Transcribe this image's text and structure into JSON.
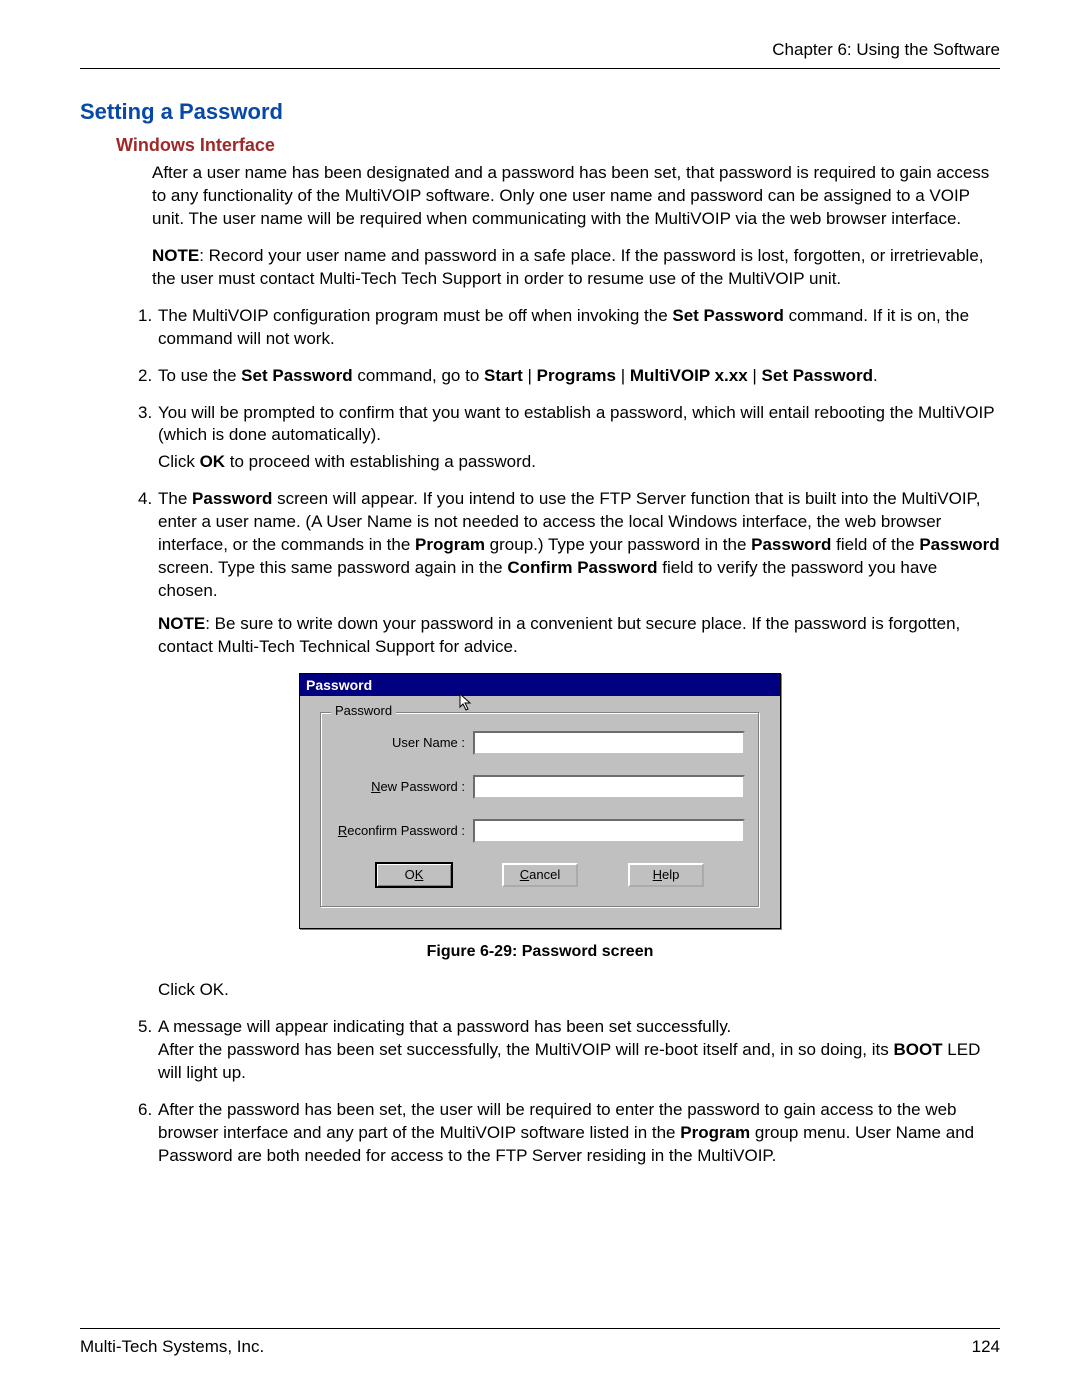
{
  "header": {
    "chapter": "Chapter 6: Using the Software"
  },
  "section": {
    "title": "Setting a Password",
    "subtitle": "Windows Interface"
  },
  "intro": "After a user name has been designated and a password has been set, that password is required to gain access to any functionality of the MultiVOIP software. Only one user name and password can be assigned to a VOIP unit.  The user name will be required when communicating with the MultiVOIP via the web browser interface.",
  "note1_label": "NOTE",
  "note1": ":  Record your user name and password in a safe place. If the password is lost, forgotten, or irretrievable, the user must contact Multi-Tech Tech Support in order to resume use of the MultiVOIP unit.",
  "steps": {
    "s1_pre": "The MultiVOIP configuration program must be off when invoking the ",
    "s1_bold": "Set Password",
    "s1_post": " command.  If it is on, the command will not work.",
    "s2_a": "To use the ",
    "s2_b1": "Set Password",
    "s2_c": " command, go to ",
    "s2_b2": "Start",
    "s2_b3": "Programs",
    "s2_b4": "MultiVOIP x.xx",
    "s2_b5": "Set Password",
    "s3": "You will be prompted to confirm that you want to establish a password, which will entail rebooting the MultiVOIP (which is done automatically).",
    "s3_click_a": "Click ",
    "s3_click_b": "OK",
    "s3_click_c": " to proceed with establishing a password.",
    "s4_a": "The ",
    "s4_b1": "Password",
    "s4_c": " screen will appear.  If you intend to use the FTP Server function that is built into the MultiVOIP, enter a user name. (A User Name is not needed to access the local Windows interface, the web browser interface, or the commands in the ",
    "s4_b2": "Program",
    "s4_d": " group.) Type your password in the ",
    "s4_b3": "Password",
    "s4_e": " field of the ",
    "s4_b4": "Password",
    "s4_f": " screen.  Type this same password again in the ",
    "s4_b5": "Confirm Password",
    "s4_g": " field to verify the password you have chosen.",
    "s4_note_label": "NOTE",
    "s4_note": ":  Be sure to write down your password in a convenient but secure place.  If the password is forgotten, contact Multi-Tech Technical Support for advice.",
    "click_ok_a": "Click ",
    "click_ok_b": "OK",
    "click_ok_c": ".",
    "s5_a": "A message will appear indicating that a password has been set successfully.",
    "s5_b": "After the password has been set successfully, the MultiVOIP will re-boot itself and, in so doing, its ",
    "s5_bold": "BOOT",
    "s5_c": " LED will light up.",
    "s6_a": "After the password has been set, the user will be required to enter the password to gain access to the web browser interface and any part of the MultiVOIP software listed in the ",
    "s6_bold": "Program",
    "s6_b": " group menu.  User Name and Password are both needed for access to the FTP Server residing in the MultiVOIP."
  },
  "dialog": {
    "title": "Password",
    "legend": "Password",
    "user_name_label": "User Name :",
    "new_password_label_pre": "N",
    "new_password_label_post": "ew Password :",
    "reconfirm_label_pre": "R",
    "reconfirm_label_post": "econfirm Password :",
    "ok_pre": "O",
    "ok_u": "K",
    "cancel_u": "C",
    "cancel_post": "ancel",
    "help_u": "H",
    "help_post": "elp",
    "user_name_value": "",
    "new_password_value": "",
    "reconfirm_value": ""
  },
  "figure_caption": "Figure 6-29: Password screen",
  "footer": {
    "company": "Multi-Tech Systems, Inc.",
    "page": "124"
  },
  "separator": " | "
}
